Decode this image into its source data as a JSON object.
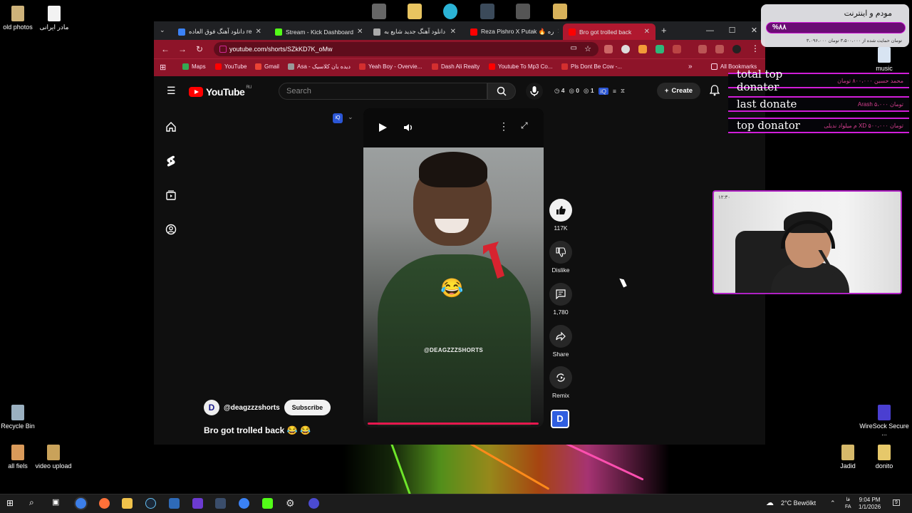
{
  "desktop": {
    "icons_left": [
      {
        "label": "old photos"
      },
      {
        "label": "مادر ایرانی"
      },
      {
        "label": "Recycle Bin"
      },
      {
        "label": "all fiels"
      },
      {
        "label": "video upload"
      }
    ],
    "icons_right": [
      {
        "label": "music"
      },
      {
        "label": "WireSock Secure ..."
      },
      {
        "label": "Jadid"
      },
      {
        "label": "donito"
      }
    ]
  },
  "browser": {
    "tabs": [
      {
        "label": "دانلود آهنگ فوق العاده re",
        "color": "#3b82f6"
      },
      {
        "label": "Stream - Kick Dashboard",
        "color": "#53fc18"
      },
      {
        "label": "دانلود آهنگ جدید شایع به",
        "color": "#aaaaaa"
      },
      {
        "label": "Reza Pishro X Putak 🔥 ره",
        "color": "#ff0000"
      },
      {
        "label": "Bro got trolled back",
        "color": "#ff0000",
        "active": true
      }
    ],
    "url": "youtube.com/shorts/SZkKD7K_oMw",
    "bookmarks": [
      {
        "label": "Maps",
        "color": "#34a853"
      },
      {
        "label": "YouTube",
        "color": "#ff0000"
      },
      {
        "label": "Gmail",
        "color": "#ea4335"
      },
      {
        "label": "Asa - دیده بان کلاسیک",
        "color": "#999999"
      },
      {
        "label": "Yeah Boy - Overvie...",
        "color": "#d32f2f"
      },
      {
        "label": "Dash Ali Realty",
        "color": "#d32f2f"
      },
      {
        "label": "Youtube To Mp3 Co...",
        "color": "#ff0000"
      },
      {
        "label": "Pls Dont Be Cow -...",
        "color": "#d32f2f"
      }
    ],
    "all_bookmarks": "All Bookmarks"
  },
  "youtube": {
    "logo": "YouTube",
    "region": "RU",
    "search_placeholder": "Search",
    "counters": [
      "4",
      "0",
      "1"
    ],
    "create_label": "Create",
    "channel": "@deagzzzshorts",
    "subscribe_label": "Subscribe",
    "title": "Bro got trolled back 😂 😂",
    "watermark": "@DEAGZZZSHORTS",
    "actions": {
      "likes": "117K",
      "dislike": "Dislike",
      "comments": "1,780",
      "share": "Share",
      "remix": "Remix"
    }
  },
  "overlay": {
    "modem_title": "مودم و اینترنت",
    "modem_percent": "%۸۸",
    "modem_sub": "۳،۰۹۶،۰۰۰ تومان حمایت شده از ۳،۵۰۰،۰۰۰ تومان",
    "donate_rows": [
      {
        "label": "total top donater",
        "value": "محمد حسین ۸۰۰،۰۰۰ تومان"
      },
      {
        "label": "last donate",
        "value": "Arash ۵،۰۰۰ تومان"
      },
      {
        "label": "top donator",
        "value": "م میلواد ندیلی XD ۵۰۰،۰۰۰ تومان"
      }
    ],
    "cam_label": "۱۲:۳۰"
  },
  "taskbar": {
    "weather": "2°C Bewölkt",
    "lang_top": "فا",
    "lang_bottom": "FA",
    "time": "9:04 PM",
    "date": "1/1/2026",
    "notif_count": "9"
  },
  "colors": {
    "accent": "#b0182f",
    "frame": "#8e1429",
    "overlay_border": "#d11dd9"
  }
}
